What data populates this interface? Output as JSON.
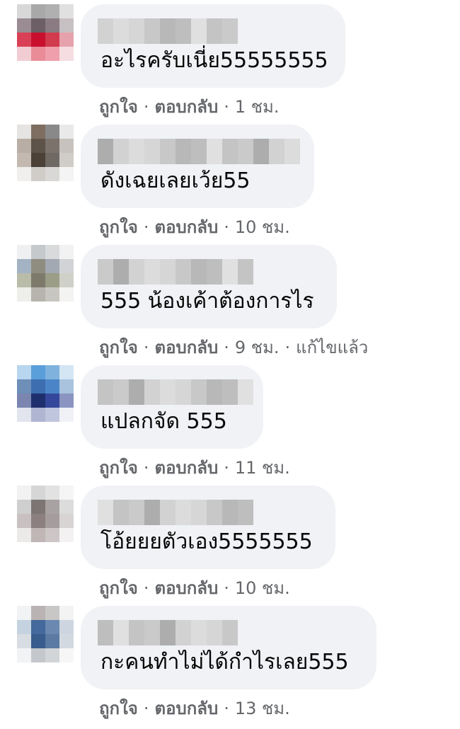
{
  "comments": [
    {
      "text": "อะไรครับเนี่ย55555555",
      "like": "ถูกใจ",
      "reply": "ตอบกลับ",
      "time": "1 ชม.",
      "edited": "",
      "avatar_colors": [
        "#d8d8d8",
        "#a8a8a8",
        "#b0b0b0",
        "#e0e0e0",
        "#9a8c92",
        "#6d5f66",
        "#8a7c82",
        "#c7c0c3",
        "#d94055",
        "#c8102e",
        "#d23a4e",
        "#e6a2ac",
        "#f1cdd3",
        "#e98c98",
        "#ef9fab",
        "#f6dde1"
      ]
    },
    {
      "text": "ดังเฉยเลยเว้ย55",
      "like": "ถูกใจ",
      "reply": "ตอบกลับ",
      "time": "10 ชม.",
      "edited": "",
      "avatar_colors": [
        "#e6e4e2",
        "#7d6e61",
        "#898989",
        "#e9e9e9",
        "#b9aea5",
        "#5e5348",
        "#7a726b",
        "#c7c2bd",
        "#c4b9b0",
        "#4b4137",
        "#6e6962",
        "#d0ccc8",
        "#f1efed",
        "#d0ccc8",
        "#dad8d6",
        "#f4f4f4"
      ]
    },
    {
      "text": "555 น้องเค้าต้องการไร",
      "like": "ถูกใจ",
      "reply": "ตอบกลับ",
      "time": "9 ชม.",
      "edited": "แก้ไขแล้ว",
      "avatar_colors": [
        "#eef0f2",
        "#c6c9cc",
        "#d8dadb",
        "#f2f2f2",
        "#a3b3c4",
        "#8f8c80",
        "#a2a9b2",
        "#d1d3d6",
        "#b9bca8",
        "#7d7a6c",
        "#9b9d86",
        "#cfd0c7",
        "#eeeeea",
        "#b7b3ad",
        "#c8c6c0",
        "#f3f3f1"
      ]
    },
    {
      "text": "แปลกจัด 555",
      "like": "ถูกใจ",
      "reply": "ตอบกลับ",
      "time": "11 ชม.",
      "edited": "",
      "avatar_colors": [
        "#b8d6ef",
        "#5a9fd9",
        "#7fb3de",
        "#d4e6f4",
        "#6d8fb8",
        "#3d6fb0",
        "#4b85c8",
        "#a9c3de",
        "#7a86b0",
        "#1f2f6e",
        "#35479a",
        "#8b94c1",
        "#e2e4ee",
        "#b0b5d1",
        "#c1c6df",
        "#f0f1f6"
      ]
    },
    {
      "text": "โอ้ยยยตัวเอง5555555",
      "like": "ถูกใจ",
      "reply": "ตอบกลับ",
      "time": "10 ชม.",
      "edited": "",
      "avatar_colors": [
        "#f2f2f2",
        "#d6d6d6",
        "#e2e2e2",
        "#f5f5f5",
        "#cfcfcf",
        "#7c7573",
        "#a8a3a2",
        "#dcdcdc",
        "#c9c0c1",
        "#8b7f80",
        "#a59c9d",
        "#d9d4d4",
        "#ece9e9",
        "#c0b6b6",
        "#cdc6c6",
        "#f3f1f1"
      ]
    },
    {
      "text": "กะคนทำไม่ได้กำไรเลย555",
      "like": "ถูกใจ",
      "reply": "ตอบกลับ",
      "time": "13 ชม.",
      "edited": "",
      "avatar_colors": [
        "#f1f3f5",
        "#b9b4b3",
        "#c9c6c6",
        "#f3f3f3",
        "#c5d2df",
        "#44699c",
        "#6a88b0",
        "#cdd6e0",
        "#d8dde3",
        "#385c8c",
        "#5b7aa4",
        "#d3d9e0",
        "#f2f3f4",
        "#c4c8cc",
        "#d2d5d8",
        "#f6f6f6"
      ]
    }
  ]
}
